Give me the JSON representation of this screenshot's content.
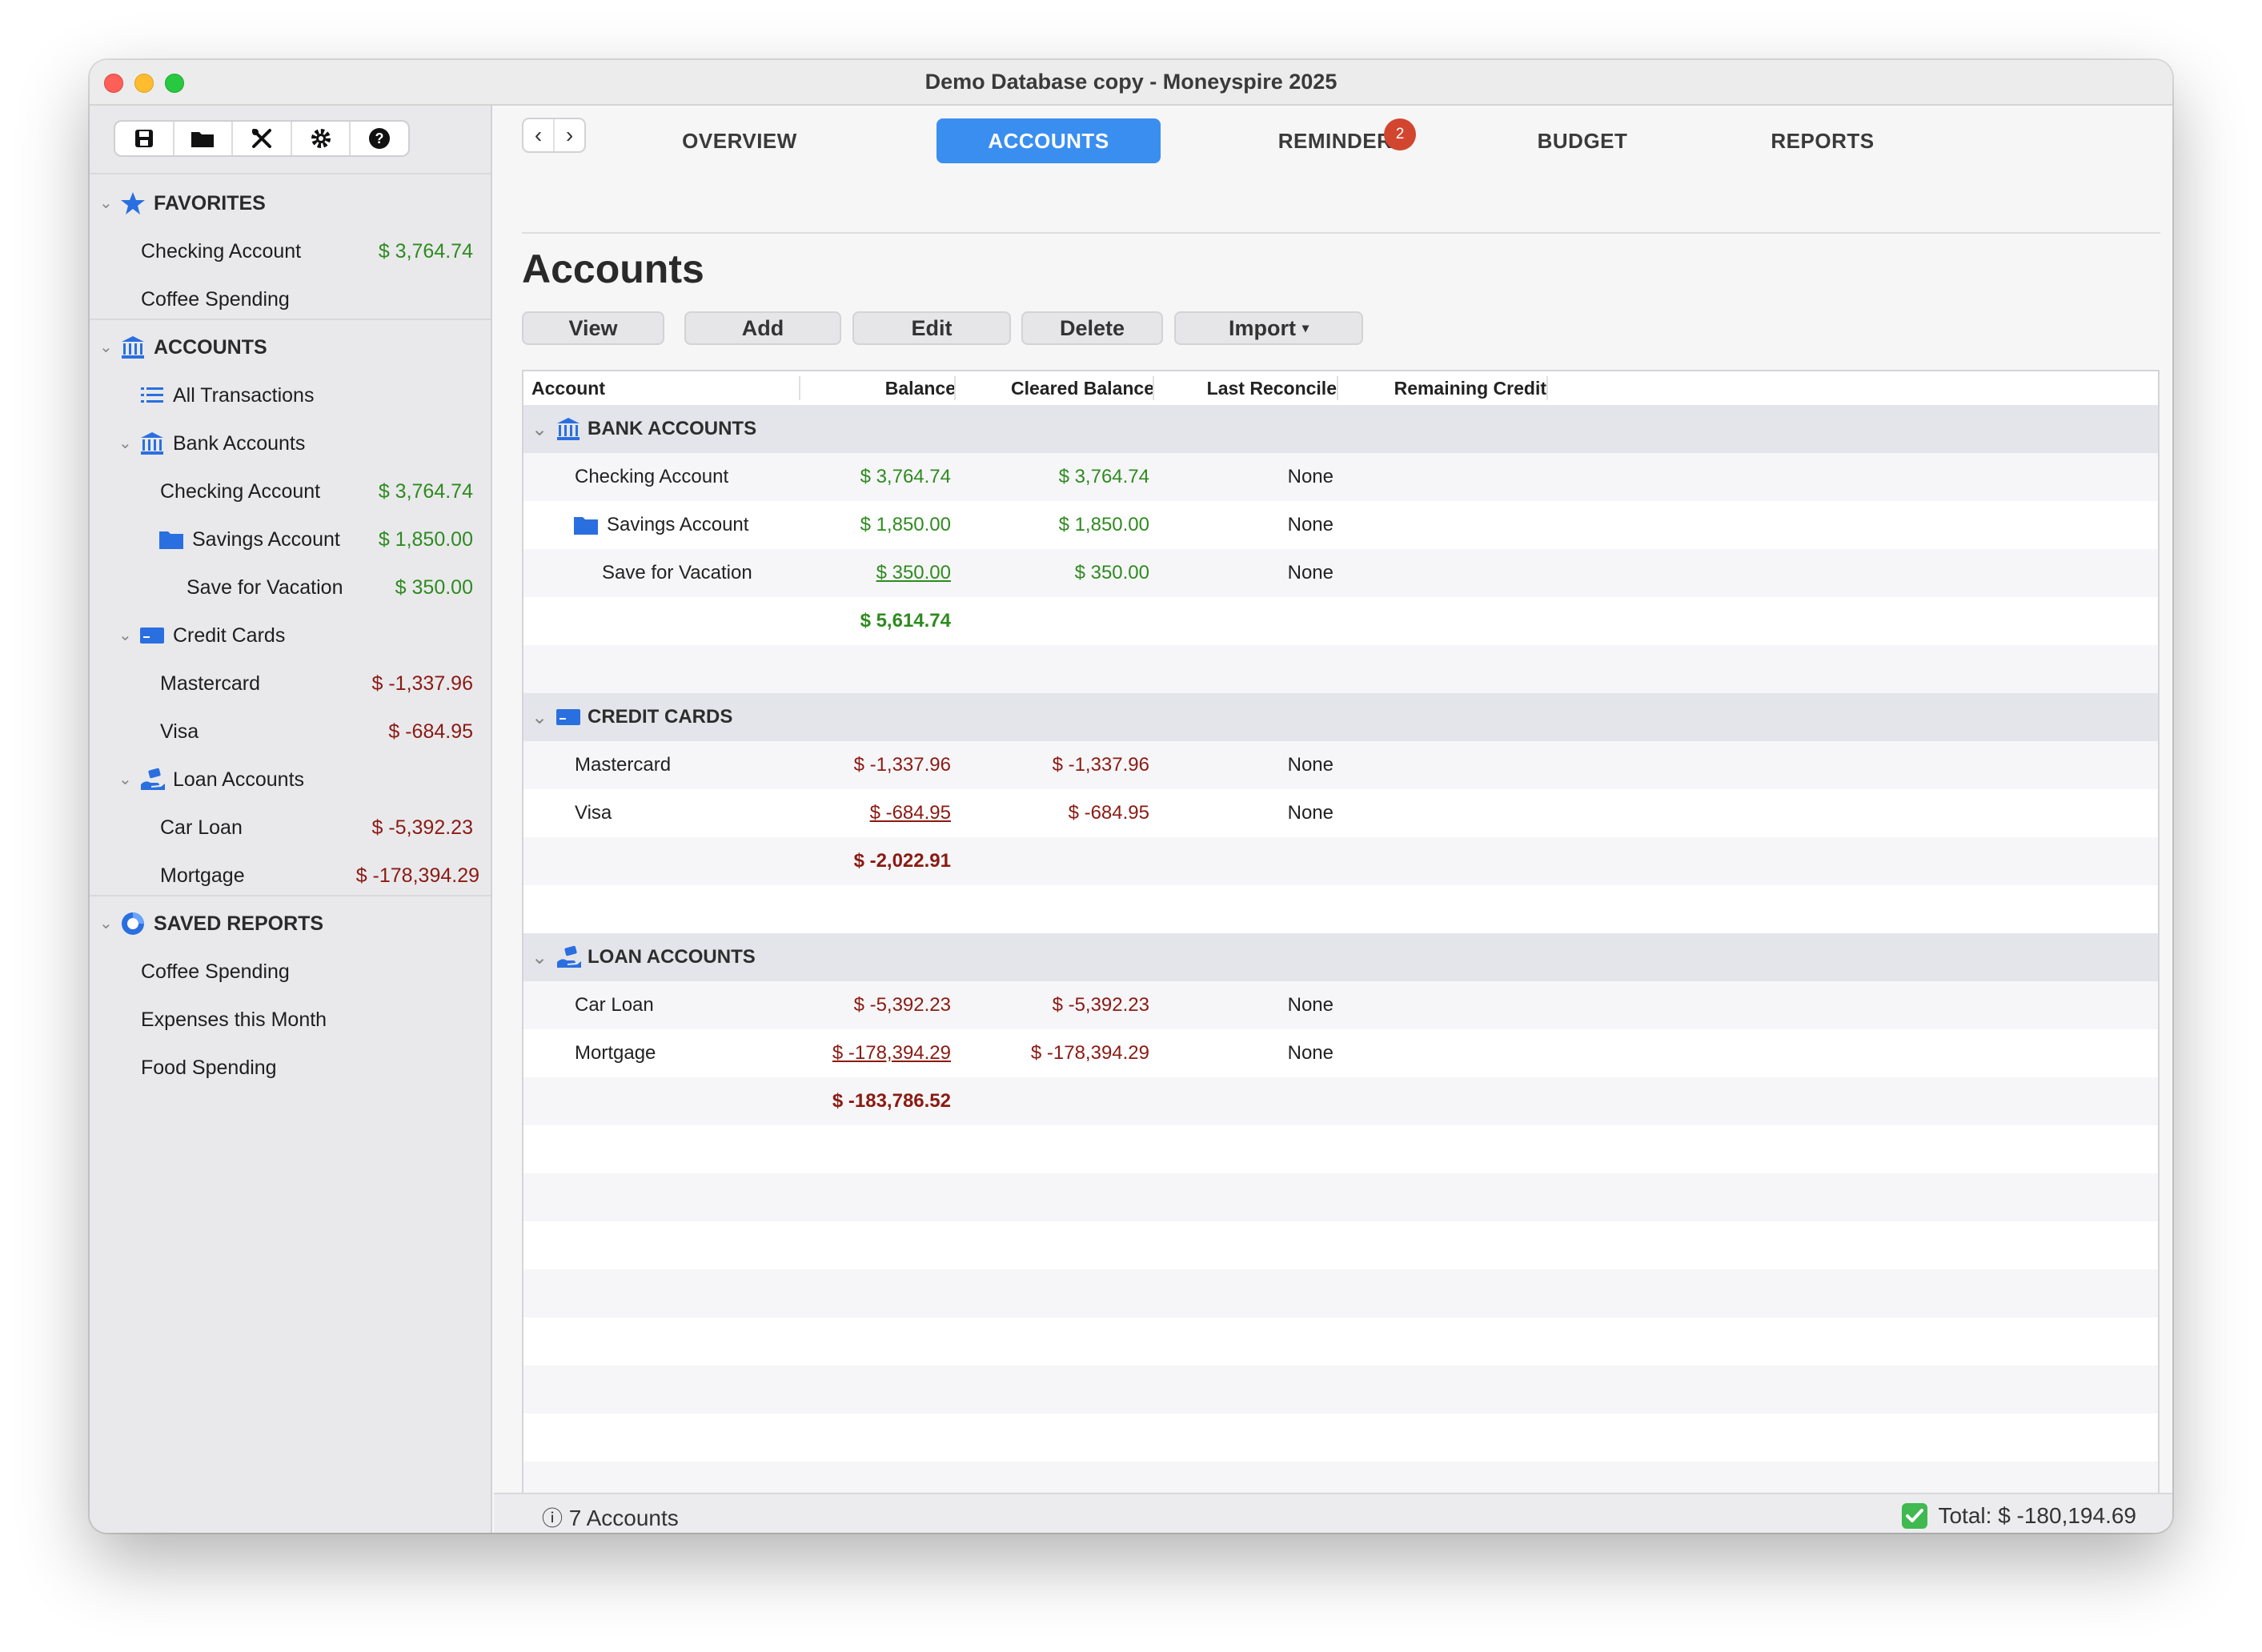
{
  "window": {
    "title": "Demo Database copy - Moneyspire 2025"
  },
  "toolbar": {
    "icons": [
      "save-icon",
      "folder-icon",
      "tools-icon",
      "gear-icon",
      "help-icon"
    ]
  },
  "sidebar": {
    "favorites": {
      "label": "FAVORITES",
      "items": [
        {
          "label": "Checking Account",
          "amount": "$ 3,764.74"
        },
        {
          "label": "Coffee Spending",
          "amount": ""
        }
      ]
    },
    "accounts": {
      "label": "ACCOUNTS",
      "all_transactions": "All Transactions",
      "bank": {
        "label": "Bank Accounts",
        "checking": {
          "label": "Checking Account",
          "amount": "$ 3,764.74"
        },
        "savings": {
          "label": "Savings Account",
          "amount": "$ 1,850.00"
        },
        "vacation": {
          "label": "Save for Vacation",
          "amount": "$ 350.00"
        }
      },
      "credit": {
        "label": "Credit Cards",
        "mastercard": {
          "label": "Mastercard",
          "amount": "$ -1,337.96"
        },
        "visa": {
          "label": "Visa",
          "amount": "$ -684.95"
        }
      },
      "loan": {
        "label": "Loan Accounts",
        "car": {
          "label": "Car Loan",
          "amount": "$ -5,392.23"
        },
        "mortgage": {
          "label": "Mortgage",
          "amount": "$ -178,394.29"
        }
      }
    },
    "saved_reports": {
      "label": "SAVED REPORTS",
      "items": [
        "Coffee Spending",
        "Expenses this Month",
        "Food Spending"
      ]
    }
  },
  "tabs": {
    "overview": "OVERVIEW",
    "accounts": "ACCOUNTS",
    "reminders": "REMINDERS",
    "reminders_badge": "2",
    "budget": "BUDGET",
    "reports": "REPORTS"
  },
  "page": {
    "title": "Accounts"
  },
  "actions": {
    "view": "View",
    "add": "Add",
    "edit": "Edit",
    "delete": "Delete",
    "import": "Import",
    "import_arrow": "▾"
  },
  "table": {
    "columns": {
      "account": "Account",
      "balance": "Balance",
      "cleared": "Cleared Balance",
      "reconcile": "Last Reconcile",
      "credit": "Remaining Credit"
    },
    "bank": {
      "header": "BANK ACCOUNTS",
      "rows": [
        {
          "account": "Checking Account",
          "balance": "$ 3,764.74",
          "cleared": "$ 3,764.74",
          "reconcile": "None"
        },
        {
          "account": "Savings Account",
          "balance": "$ 1,850.00",
          "cleared": "$ 1,850.00",
          "reconcile": "None"
        },
        {
          "account": "Save for Vacation",
          "balance": "$ 350.00",
          "cleared": "$ 350.00",
          "reconcile": "None"
        }
      ],
      "total": "$ 5,614.74"
    },
    "credit": {
      "header": "CREDIT CARDS",
      "rows": [
        {
          "account": "Mastercard",
          "balance": "$ -1,337.96",
          "cleared": "$ -1,337.96",
          "reconcile": "None"
        },
        {
          "account": "Visa",
          "balance": "$ -684.95",
          "cleared": "$ -684.95",
          "reconcile": "None"
        }
      ],
      "total": "$ -2,022.91"
    },
    "loan": {
      "header": "LOAN ACCOUNTS",
      "rows": [
        {
          "account": "Car Loan",
          "balance": "$ -5,392.23",
          "cleared": "$ -5,392.23",
          "reconcile": "None"
        },
        {
          "account": "Mortgage",
          "balance": "$ -178,394.29",
          "cleared": "$ -178,394.29",
          "reconcile": "None"
        }
      ],
      "total": "$ -183,786.52"
    }
  },
  "status": {
    "count": "7 Accounts",
    "total": "Total: $ -180,194.69"
  },
  "colors": {
    "accent": "#3a8ef0",
    "positive": "#2e8b1f",
    "negative": "#8b1a12",
    "badge": "#d2452f"
  }
}
